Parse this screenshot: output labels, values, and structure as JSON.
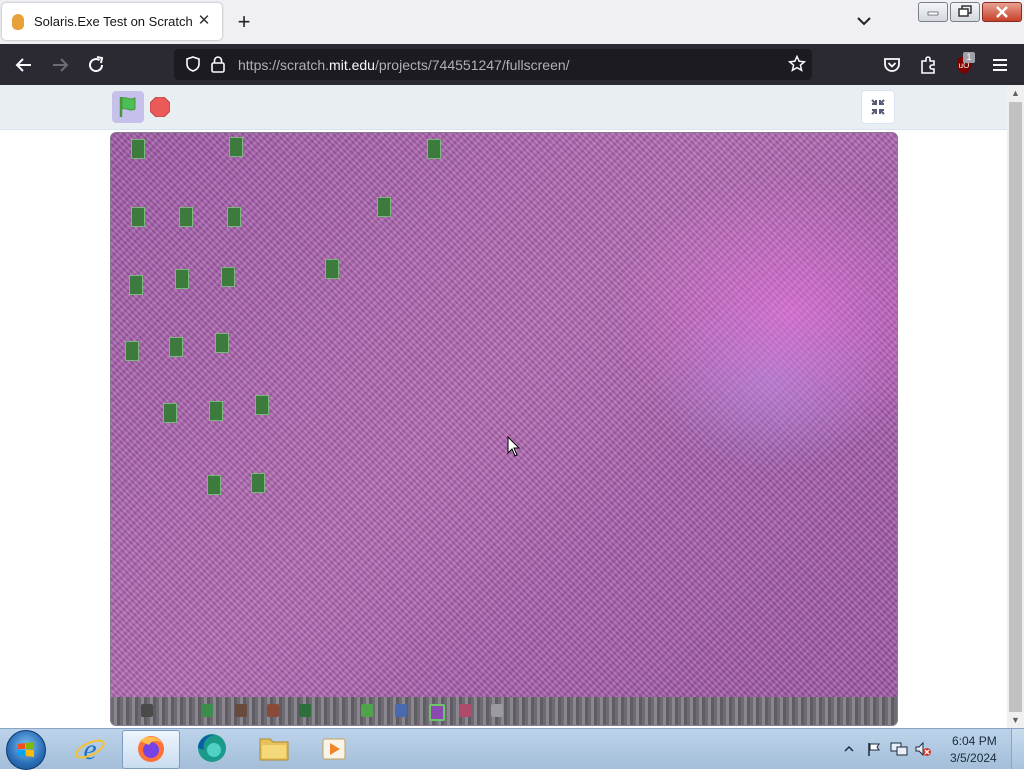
{
  "browser": {
    "tab_title": "Solaris.Exe Test on Scratch",
    "url_prefix": "https://scratch.",
    "url_domain": "mit.edu",
    "url_path": "/projects/744551247/fullscreen/",
    "extension_badge": "1"
  },
  "scratch": {
    "green_flag": "green-flag-icon",
    "stop": "stop-icon",
    "exit_fullscreen": "exit-fullscreen-icon"
  },
  "taskbar": {
    "apps": [
      "internet-explorer-icon",
      "firefox-icon",
      "edge-icon",
      "file-explorer-icon",
      "media-player-icon"
    ],
    "clock_time": "6:04 PM",
    "clock_date": "3/5/2024"
  },
  "colors": {
    "stage_purple": "#a761ad",
    "browser_dark": "#2b2a33",
    "scratch_flag_bg": "#c6c1ea"
  }
}
